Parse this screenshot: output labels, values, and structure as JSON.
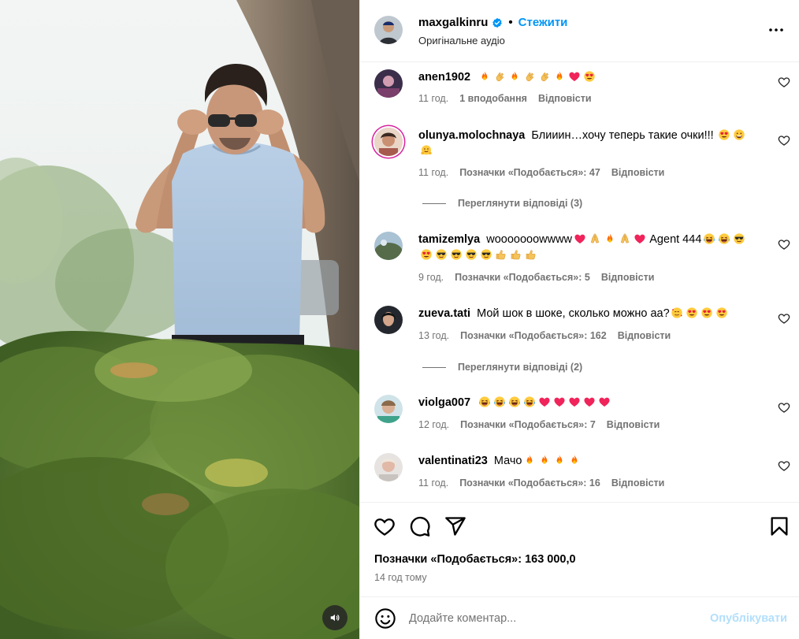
{
  "post": {
    "author": "maxgalkinru",
    "follow_label": "Стежити",
    "separator": "•",
    "audio_label": "Оригінальне аудіо"
  },
  "comments": [
    {
      "username": "anen1902",
      "text": "",
      "emojis": [
        "fire",
        "clap",
        "fire",
        "clap",
        "clap",
        "fire",
        "heart",
        "heart-eyes"
      ],
      "time": "11 год.",
      "likes_label": "1 вподобання",
      "reply_label": "Відповісти"
    },
    {
      "username": "olunya.molochnaya",
      "text": "Блииин…хочу теперь такие очки!!!",
      "emojis": [
        "heart-eyes",
        "grin",
        "hug"
      ],
      "time": "11 год.",
      "likes_label": "Позначки «Подобається»: 47",
      "reply_label": "Відповісти",
      "view_replies": "Переглянути відповіді (3)"
    },
    {
      "username": "tamizemlya",
      "text": "wooooooowwww",
      "text2": "Agent 444",
      "emojis_a": [
        "heart",
        "pray",
        "fire",
        "pray",
        "heart"
      ],
      "emojis_b": [
        "laugh",
        "laugh",
        "cool",
        "heart-eyes",
        "cool",
        "cool",
        "cool",
        "cool",
        "thumb",
        "thumb",
        "thumb"
      ],
      "time": "9 год.",
      "likes_label": "Позначки «Подобається»: 5",
      "reply_label": "Відповісти"
    },
    {
      "username": "zueva.tati",
      "text": "Мой шок в шоке, сколько можно аа?",
      "emojis": [
        "hearts-face",
        "heart-eyes",
        "heart-eyes",
        "heart-eyes"
      ],
      "time": "13 год.",
      "likes_label": "Позначки «Подобається»: 162",
      "reply_label": "Відповісти",
      "view_replies": "Переглянути відповіді (2)"
    },
    {
      "username": "violga007",
      "text": "",
      "emojis": [
        "laugh",
        "laugh",
        "laugh",
        "laugh",
        "heart",
        "heart",
        "heart",
        "heart",
        "heart"
      ],
      "time": "12 год.",
      "likes_label": "Позначки «Подобається»: 7",
      "reply_label": "Відповісти"
    },
    {
      "username": "valentinati23",
      "text": "Мачо",
      "emojis": [
        "fire",
        "fire",
        "fire",
        "fire"
      ],
      "time": "11 год.",
      "likes_label": "Позначки «Подобається»: 16",
      "reply_label": "Відповісти"
    }
  ],
  "actions": {
    "likes_count": "Позначки «Подобається»: 163 000,0",
    "posted_ago": "14 год тому"
  },
  "composer": {
    "placeholder": "Додайте коментар...",
    "publish_label": "Опублікувати"
  },
  "icons": {
    "verified": "verified-badge-icon",
    "more": "more-options-icon",
    "like": "heart-icon",
    "comment": "comment-icon",
    "share": "share-icon",
    "save": "bookmark-icon",
    "emoji": "emoji-icon",
    "audio": "speaker-icon"
  },
  "colors": {
    "accent": "#0095f6",
    "muted": "#737373",
    "publish_disabled": "#b2dffc",
    "divider": "#efefef"
  }
}
